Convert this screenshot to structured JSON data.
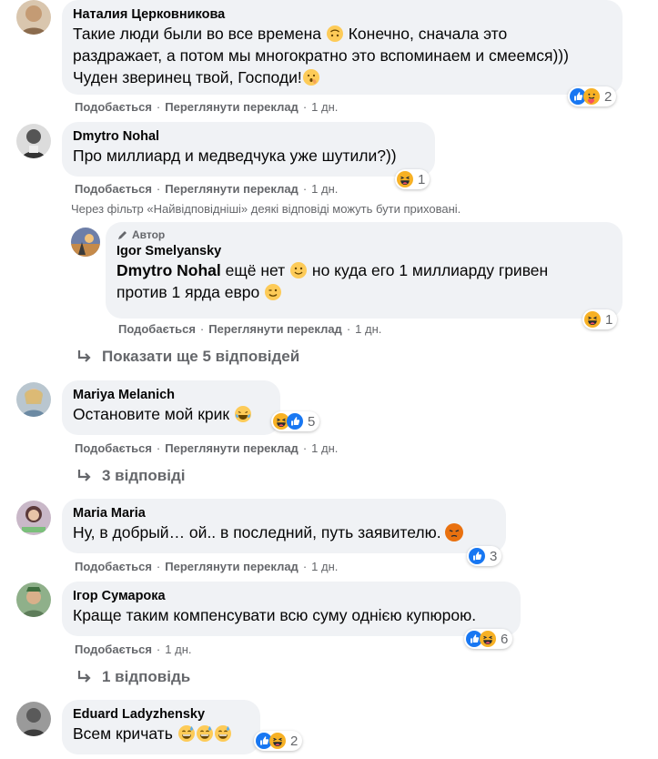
{
  "colors": {
    "bubble": "#f0f2f5",
    "meta": "#65676b",
    "like": "#1877f2",
    "haha": "#f7b125",
    "angry": "#e9710f"
  },
  "comments": [
    {
      "author": "Наталия Церковникова",
      "lines": [
        "Такие люди были во все времена",
        "Конечно, сначала это",
        "раздражает, а потом мы многократно это вспоминаем и смеемся)))",
        "Чуден зверинец твой, Господи!"
      ],
      "actions": [
        "Подобається",
        "Переглянути переклад",
        "1 дн."
      ],
      "reactions": [
        "like-icon",
        "care-icon"
      ],
      "count": "2"
    },
    {
      "author": "Dmytro Nohal",
      "text": "Про миллиард и медведчука уже шутили?))",
      "actions": [
        "Подобається",
        "Переглянути переклад",
        "1 дн."
      ],
      "reactions": [
        "haha-icon"
      ],
      "count": "1"
    },
    {
      "author": "Mariya Melanich",
      "text": "Остановите мой крик",
      "actions": [
        "Подобається",
        "Переглянути переклад",
        "1 дн."
      ],
      "reactions": [
        "haha-icon",
        "like-icon"
      ],
      "count": "5"
    },
    {
      "author": "Maria Maria",
      "text": "Ну, в добрый… ой.. в последний, путь заявителю.",
      "actions": [
        "Подобається",
        "Переглянути переклад",
        "1 дн."
      ],
      "reactions": [
        "like-icon"
      ],
      "count": "3"
    },
    {
      "author": "Ігор Сумарока",
      "text": "Краще таким компенсувати всю суму однією купюрою.",
      "actions": [
        "Подобається",
        "1 дн."
      ],
      "reactions": [
        "like-icon",
        "haha-icon"
      ],
      "count": "6"
    },
    {
      "author": "Eduard Ladyzhensky",
      "text": "Всем кричать",
      "reactions": [
        "like-icon",
        "haha-icon"
      ],
      "count": "2"
    }
  ],
  "filter_note": "Через фільтр «Найвідповідніші» деякі відповіді можуть бути приховані.",
  "reply": {
    "badge": "Автор",
    "author": "Igor Smelyansky",
    "mention": "Dmytro Nohal",
    "line1": "ещё нет",
    "line1b": "но куда его 1 миллиарду гривен",
    "line2": "против 1 ярда евро",
    "actions": [
      "Подобається",
      "Переглянути переклад",
      "1 дн."
    ],
    "count": "1"
  },
  "more_replies": {
    "show5": "Показати ще 5 відповідей",
    "three": "3 відповіді",
    "one": "1 відповідь"
  }
}
